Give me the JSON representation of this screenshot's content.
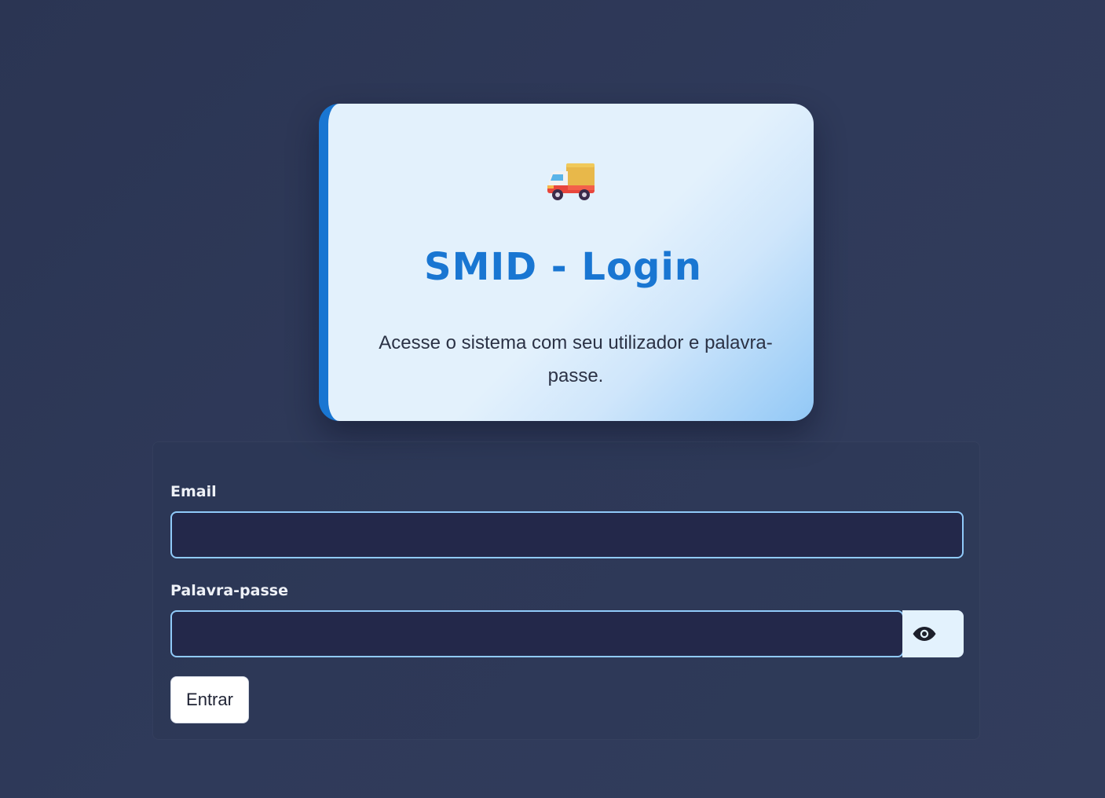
{
  "header": {
    "icon": "truck-icon",
    "title": "SMID - Login",
    "subtitle": "Acesse o sistema com seu utilizador e palavra-passe."
  },
  "form": {
    "email": {
      "label": "Email",
      "value": "",
      "placeholder": ""
    },
    "password": {
      "label": "Palavra-passe",
      "value": "",
      "placeholder": "",
      "toggle_icon": "eye-icon"
    },
    "submit_label": "Entrar"
  },
  "colors": {
    "background": "#2f3a5a",
    "accent": "#1976d2",
    "input_border": "#90caf9",
    "input_bg": "#23284a"
  }
}
